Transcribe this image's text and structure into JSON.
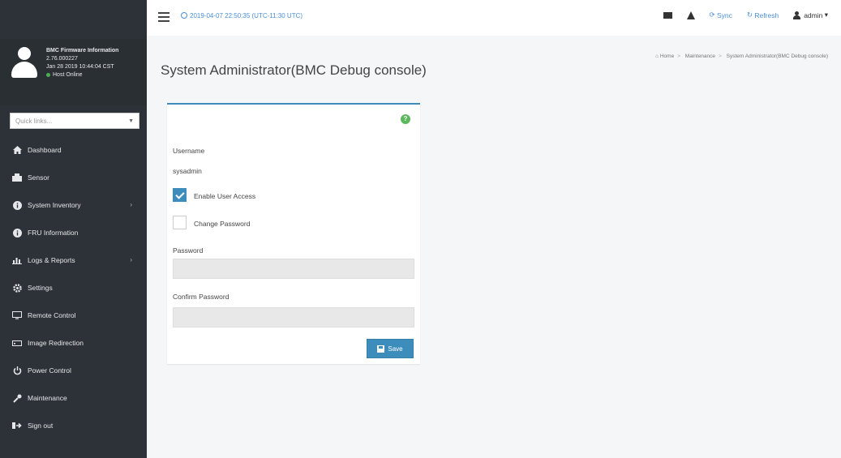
{
  "sidebar": {
    "user": {
      "title": "BMC Firmware Information",
      "version": "2.76.000227",
      "build_date": "Jan 28 2019 10:44:04 CST",
      "status": "Host Online"
    },
    "quicklinks_placeholder": "Quick links...",
    "items": [
      {
        "label": "Dashboard"
      },
      {
        "label": "Sensor"
      },
      {
        "label": "System Inventory"
      },
      {
        "label": "FRU Information"
      },
      {
        "label": "Logs & Reports"
      },
      {
        "label": "Settings"
      },
      {
        "label": "Remote Control"
      },
      {
        "label": "Image Redirection"
      },
      {
        "label": "Power Control"
      },
      {
        "label": "Maintenance"
      },
      {
        "label": "Sign out"
      }
    ]
  },
  "header": {
    "datetime": "2019-04-07 22:50:35 (UTC-11:30 UTC)",
    "sync_label": "Sync",
    "refresh_label": "Refresh",
    "user_label": "admin"
  },
  "page": {
    "title": "System Administrator(BMC Debug console)",
    "breadcrumb": [
      "Home",
      "Maintenance",
      "System Administrator(BMC Debug console)"
    ]
  },
  "form": {
    "username_label": "Username",
    "username_value": "sysadmin",
    "enable_access_label": "Enable User Access",
    "enable_access_checked": true,
    "change_password_label": "Change Password",
    "change_password_checked": false,
    "password_label": "Password",
    "confirm_password_label": "Confirm Password",
    "save_label": "Save"
  },
  "colors": {
    "sidebar_bg": "#2d3238",
    "accent": "#3c8dbc",
    "help": "#5cb85c"
  }
}
